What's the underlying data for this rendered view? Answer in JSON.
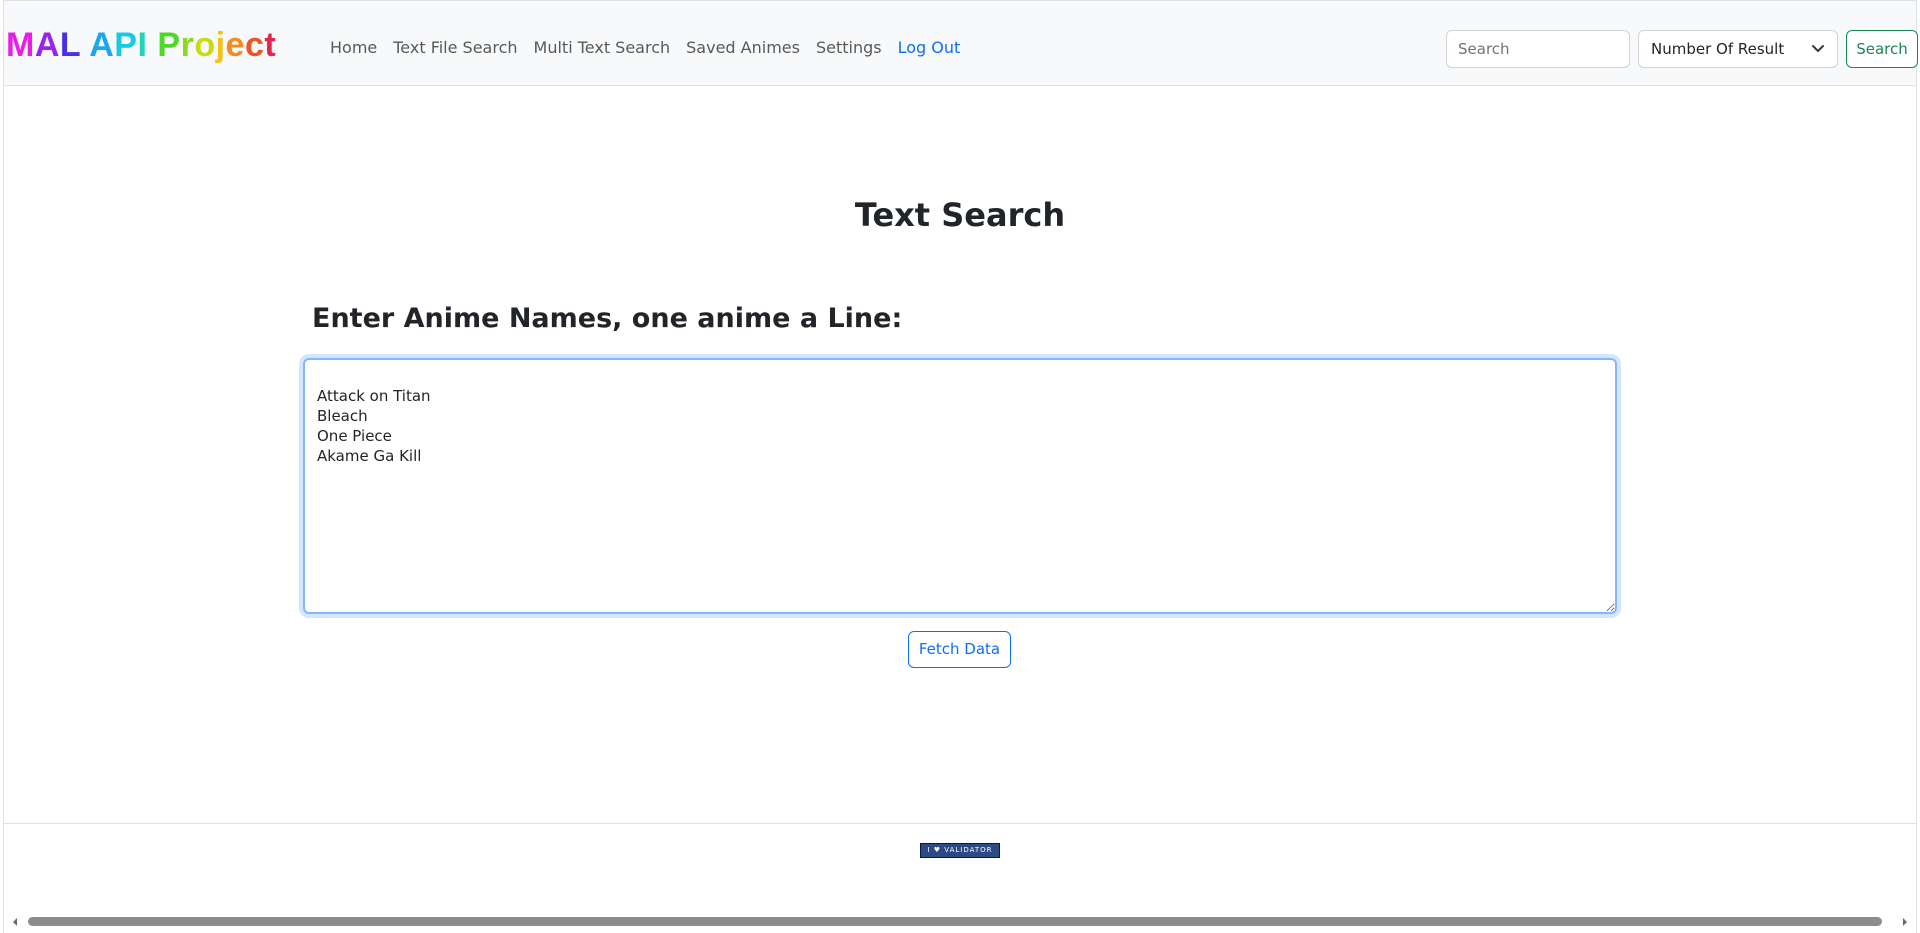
{
  "navbar": {
    "brand_letters": [
      {
        "char": "M",
        "color": "#e91ee6"
      },
      {
        "char": "A",
        "color": "#9b23e8"
      },
      {
        "char": "L",
        "color": "#4b2ee8"
      },
      {
        "char": " ",
        "color": "#000000"
      },
      {
        "char": "A",
        "color": "#1aa7f0"
      },
      {
        "char": "P",
        "color": "#18c9e6"
      },
      {
        "char": "I",
        "color": "#20d4b8"
      },
      {
        "char": " ",
        "color": "#000000"
      },
      {
        "char": "P",
        "color": "#4fd82a"
      },
      {
        "char": "r",
        "color": "#8ed81e"
      },
      {
        "char": "o",
        "color": "#c8dc16"
      },
      {
        "char": "j",
        "color": "#f2c21a"
      },
      {
        "char": "e",
        "color": "#f58a1e"
      },
      {
        "char": "c",
        "color": "#f25326"
      },
      {
        "char": "t",
        "color": "#e8224e"
      }
    ],
    "links": [
      "Home",
      "Text File Search",
      "Multi Text Search",
      "Saved Animes",
      "Settings",
      "Log Out"
    ],
    "active_link": "Log Out",
    "search": {
      "placeholder": "Search",
      "value": ""
    },
    "select": {
      "selected": "Number Of Result"
    },
    "search_button": "Search"
  },
  "main": {
    "title": "Text Search",
    "heading": "Enter Anime Names, one anime a Line:",
    "textarea_value": "Attack on Titan\nBleach\nOne Piece\nAkame Ga Kill",
    "fetch_button": "Fetch Data"
  },
  "footer": {
    "badge_text": "I ♥ VALIDATOR"
  },
  "colors": {
    "accent": "#0d6efd",
    "success": "#198754",
    "navbar_bg": "#f8f9fa"
  }
}
